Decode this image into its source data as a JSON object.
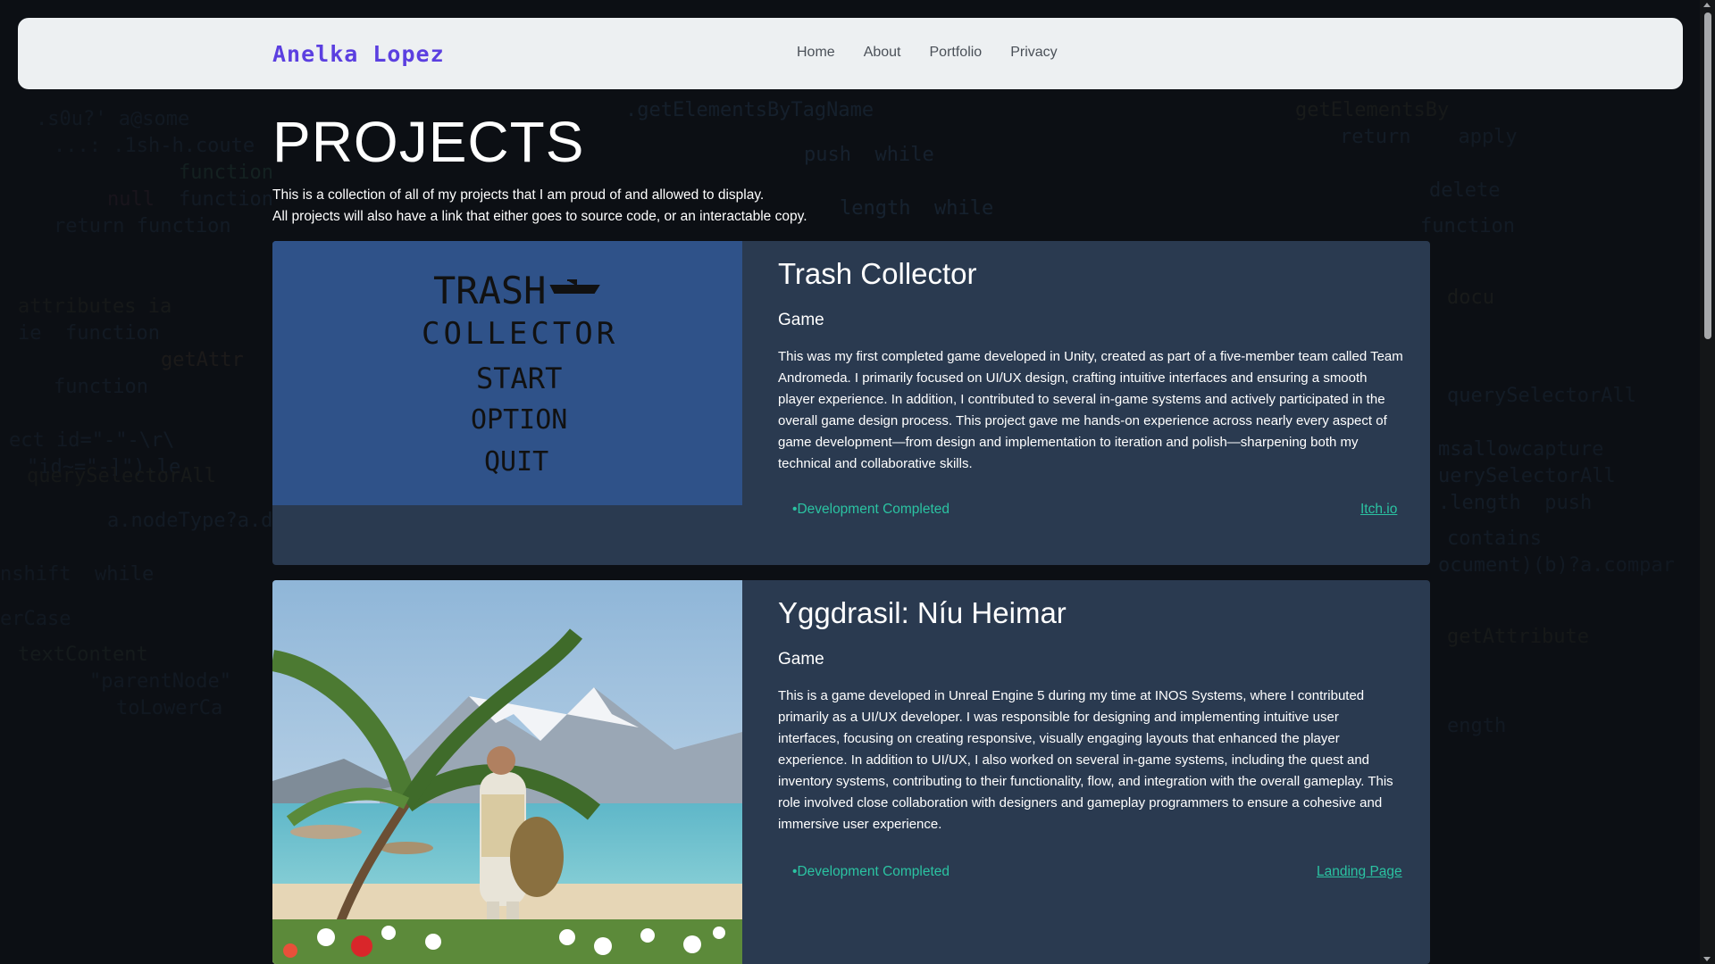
{
  "nav": {
    "brand": "Anelka Lopez",
    "links": [
      "Home",
      "About",
      "Portfolio",
      "Privacy"
    ]
  },
  "page": {
    "title": "PROJECTS",
    "intro_line1": "This is a collection of all of my projects that I am proud of and allowed to display.",
    "intro_line2": "All projects will also have a link that either goes to source code, or an interactable copy."
  },
  "projects": [
    {
      "title": "Trash Collector",
      "type": "Game",
      "description": "This was my first completed game developed in Unity, created as part of a five-member team called Team Andromeda. I primarily focused on UI/UX design, crafting intuitive interfaces and ensuring a smooth player experience. In addition, I contributed to several in-game systems and actively participated in the overall game design process. This project gave me hands-on experience across nearly every aspect of game development—from design and implementation to iteration and polish—sharpening both my technical and collaborative skills.",
      "status": "Development Completed",
      "link_label": "Itch.io",
      "image": {
        "line1": "TRASH",
        "line2": "COLLECTOR",
        "menu": [
          "START",
          "OPTION",
          "QUIT"
        ]
      }
    },
    {
      "title": "Yggdrasil: Níu Heimar",
      "type": "Game",
      "description": "This is a game developed in Unreal Engine 5 during my time at INOS Systems, where I contributed primarily as a UI/UX developer. I was responsible for designing and implementing intuitive user interfaces, focusing on creating responsive, visually engaging layouts that enhanced the player experience. In addition to UI/UX, I also worked on several in-game systems, including the quest and inventory systems, contributing to their functionality, flow, and integration with the overall gameplay. This role involved close collaboration with designers and gameplay programmers to ensure a cohesive and immersive user experience.",
      "status": "Development Completed",
      "link_label": "Landing Page"
    }
  ]
}
